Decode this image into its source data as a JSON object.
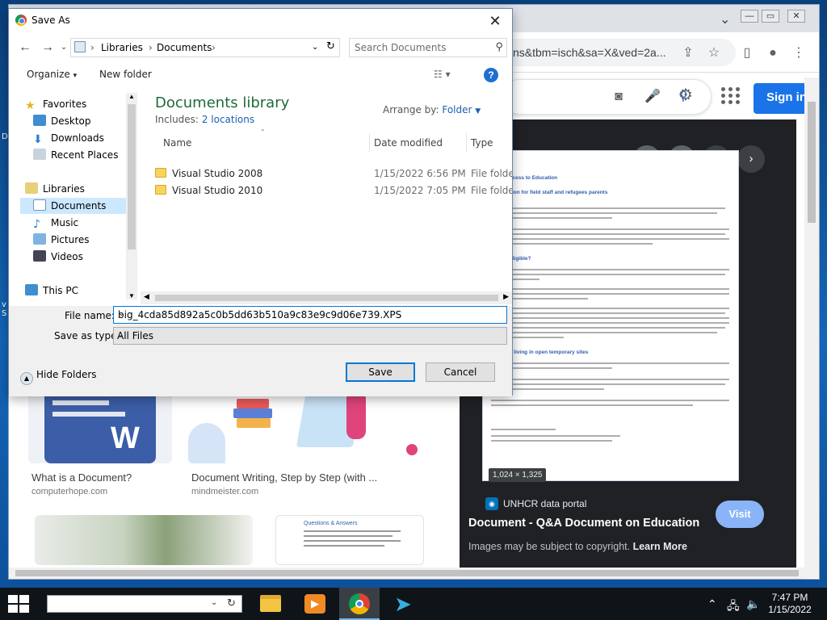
{
  "dialog": {
    "title": "Save As",
    "breadcrumb": [
      "Libraries",
      "Documents"
    ],
    "search_placeholder": "Search Documents",
    "organize_label": "Organize",
    "new_folder_label": "New folder",
    "nav_items": [
      {
        "label": "Favorites",
        "icon": "star-icon"
      },
      {
        "label": "Desktop",
        "icon": "desktop-icon"
      },
      {
        "label": "Downloads",
        "icon": "downloads-icon"
      },
      {
        "label": "Recent Places",
        "icon": "recent-places-icon"
      },
      {
        "label": "Libraries",
        "icon": "libraries-icon"
      },
      {
        "label": "Documents",
        "icon": "documents-icon"
      },
      {
        "label": "Music",
        "icon": "music-icon"
      },
      {
        "label": "Pictures",
        "icon": "pictures-icon"
      },
      {
        "label": "Videos",
        "icon": "videos-icon"
      },
      {
        "label": "This PC",
        "icon": "computer-icon"
      }
    ],
    "library_title": "Documents library",
    "includes_label": "Includes:",
    "includes_link": "2 locations",
    "arrange_label": "Arrange by:",
    "arrange_value": "Folder",
    "columns": [
      "Name",
      "Date modified",
      "Type"
    ],
    "files": [
      {
        "name": "Visual Studio 2008",
        "date": "1/15/2022 6:56 PM",
        "type": "File folder"
      },
      {
        "name": "Visual Studio 2010",
        "date": "1/15/2022 7:05 PM",
        "type": "File folder"
      }
    ],
    "file_name_label": "File name:",
    "file_name_value": "big_4cda85d892a5c0b5dd63b510a9c83e9c9d06e739.XPS",
    "save_type_label": "Save as type:",
    "save_type_value": "All Files",
    "hide_folders_label": "Hide Folders",
    "save_label": "Save",
    "cancel_label": "Cancel"
  },
  "browser": {
    "url_fragment": "ns&tbm=isch&sa=X&ved=2a...",
    "signin_label": "Sign in",
    "results": [
      {
        "title": "What is a Document?",
        "source": "computerhope.com"
      },
      {
        "title": "Document Writing, Step by Step (with ...",
        "source": "mindmeister.com"
      }
    ],
    "thumb_heading": "Questions & Answers",
    "preview": {
      "dimensions": "1,024 × 1,325",
      "source": "UNHCR data portal",
      "title": "Document - Q&A Document on Education",
      "copyright_text": "Images may be subject to copyright.",
      "learn_more": "Learn More",
      "visit_label": "Visit",
      "doc_headings": [
        "Q&A: Access to Education",
        "Information for field staff and refugees parents",
        "Who is eligible?",
        "Children living in open temporary sites"
      ]
    }
  },
  "taskbar": {
    "time": "7:47 PM",
    "date": "1/15/2022"
  },
  "colors": {
    "accent": "#0078d7",
    "library_title": "#1e6b3a",
    "link": "#1a5fb4",
    "signin_bg": "#1a73e8"
  }
}
